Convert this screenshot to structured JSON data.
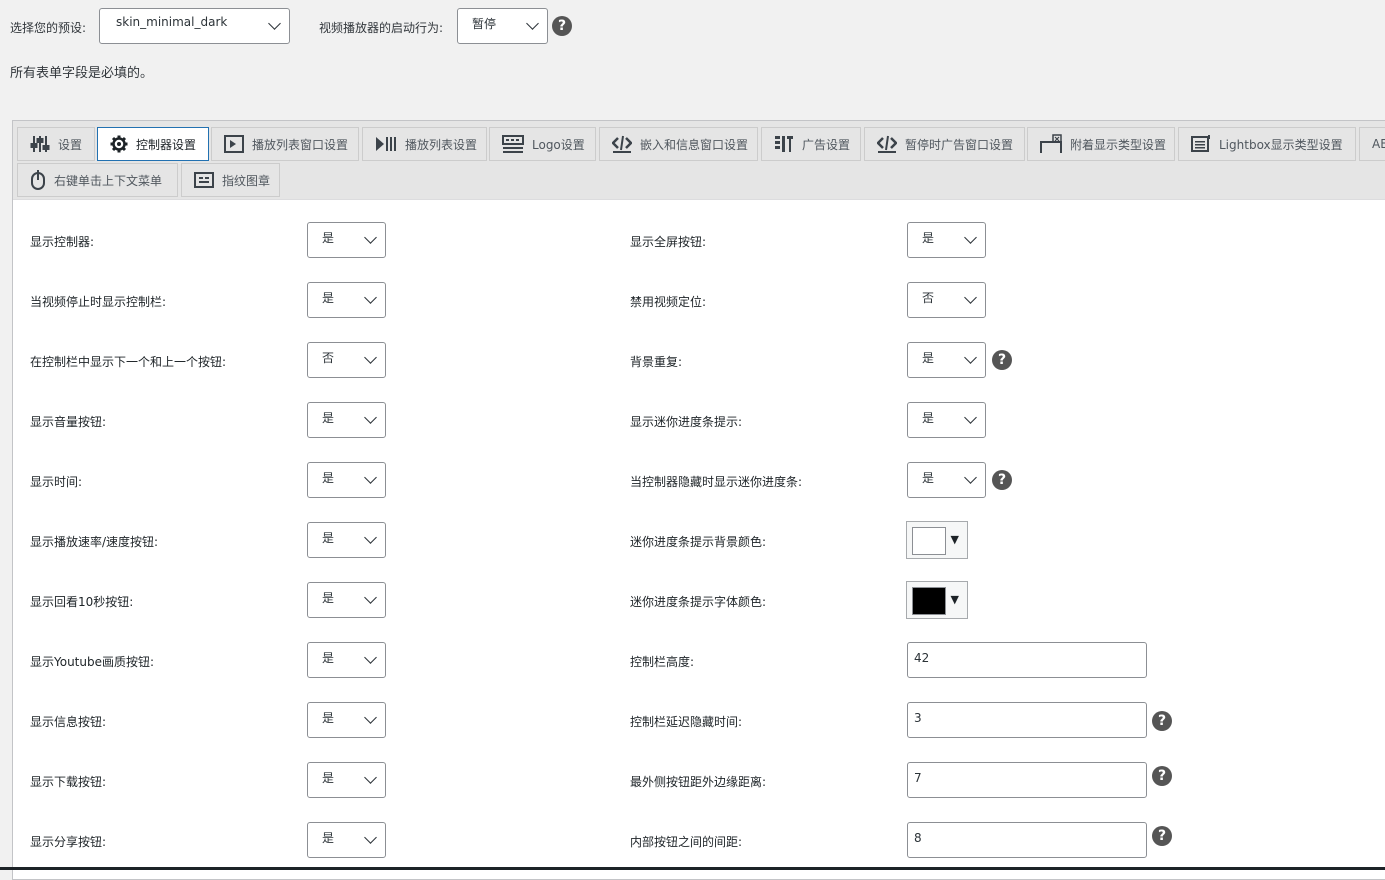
{
  "top": {
    "preset_label": "选择您的预设:",
    "preset_value": "skin_minimal_dark",
    "startup_label": "视频播放器的启动行为:",
    "startup_value": "暂停",
    "required_note": "所有表单字段是必填的。"
  },
  "tabs": [
    {
      "label": "设置",
      "icon": "sliders-icon"
    },
    {
      "label": "控制器设置",
      "icon": "gear-icon"
    },
    {
      "label": "播放列表窗口设置",
      "icon": "playlist-window-icon"
    },
    {
      "label": "播放列表设置",
      "icon": "playlist-icon"
    },
    {
      "label": "Logo设置",
      "icon": "logo-icon"
    },
    {
      "label": "嵌入和信息窗口设置",
      "icon": "embed-icon"
    },
    {
      "label": "广告设置",
      "icon": "ads-icon"
    },
    {
      "label": "暂停时广告窗口设置",
      "icon": "pause-ads-icon"
    },
    {
      "label": "附着显示类型设置",
      "icon": "sticky-display-icon"
    },
    {
      "label": "Lightbox显示类型设置",
      "icon": "lightbox-icon"
    },
    {
      "label": "AB",
      "icon": ""
    },
    {
      "label": "右键单击上下文菜单",
      "icon": "mouse-icon"
    },
    {
      "label": "指纹图章",
      "icon": "fingerprint-icon"
    }
  ],
  "left_settings": [
    {
      "label": "显示控制器:",
      "value": "是"
    },
    {
      "label": "当视频停止时显示控制栏:",
      "value": "是"
    },
    {
      "label": "在控制栏中显示下一个和上一个按钮:",
      "value": "否"
    },
    {
      "label": "显示音量按钮:",
      "value": "是"
    },
    {
      "label": "显示时间:",
      "value": "是"
    },
    {
      "label": "显示播放速率/速度按钮:",
      "value": "是"
    },
    {
      "label": "显示回看10秒按钮:",
      "value": "是"
    },
    {
      "label": "显示Youtube画质按钮:",
      "value": "是"
    },
    {
      "label": "显示信息按钮:",
      "value": "是"
    },
    {
      "label": "显示下载按钮:",
      "value": "是"
    },
    {
      "label": "显示分享按钮:",
      "value": "是"
    }
  ],
  "right_settings": [
    {
      "label": "显示全屏按钮:",
      "value": "是"
    },
    {
      "label": "禁用视频定位:",
      "value": "否"
    },
    {
      "label": "背景重复:",
      "value": "是"
    },
    {
      "label": "显示迷你进度条提示:",
      "value": "是"
    },
    {
      "label": "当控制器隐藏时显示迷你进度条:",
      "value": "是"
    },
    {
      "label": "迷你进度条提示背景颜色:",
      "color": "#ffffff"
    },
    {
      "label": "迷你进度条提示字体颜色:",
      "color": "#000000"
    },
    {
      "label": "控制栏高度:",
      "value": "42"
    },
    {
      "label": "控制栏延迟隐藏时间:",
      "value": "3"
    },
    {
      "label": "最外侧按钮距外边缘距离:",
      "value": "7"
    },
    {
      "label": "内部按钮之间的间距:",
      "value": "8"
    }
  ],
  "help_glyph": "?",
  "dropdown_arrow": "▼",
  "colors": {
    "active_tab_border": "#2271b1",
    "help_bg": "#555555"
  }
}
